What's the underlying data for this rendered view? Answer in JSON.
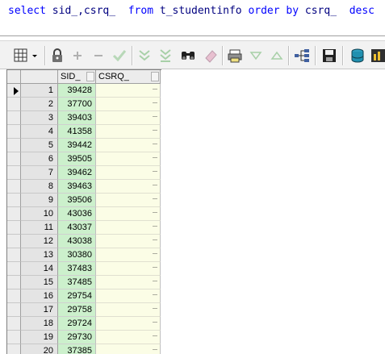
{
  "sql": {
    "kw_select": "select",
    "cols": "sid_,csrq_",
    "kw_from": "from",
    "table": "t_studentinfo",
    "kw_order": "order by",
    "order_col": "csrq_",
    "kw_desc": "desc"
  },
  "toolbar": {
    "icons": [
      "grid-icon",
      "lock-icon",
      "plus-icon",
      "minus-icon",
      "check-icon",
      "filter-down-icon",
      "filter-clear-icon",
      "binoculars-icon",
      "eraser-icon",
      "print-icon",
      "triangle-down-icon",
      "triangle-up-icon",
      "tree-icon",
      "save-icon",
      "database-icon",
      "chart-icon"
    ]
  },
  "grid": {
    "columns": [
      "SID_",
      "CSRQ_"
    ],
    "rows": [
      {
        "n": "1",
        "sid": "39428",
        "csrq": ""
      },
      {
        "n": "2",
        "sid": "37700",
        "csrq": ""
      },
      {
        "n": "3",
        "sid": "39403",
        "csrq": ""
      },
      {
        "n": "4",
        "sid": "41358",
        "csrq": ""
      },
      {
        "n": "5",
        "sid": "39442",
        "csrq": ""
      },
      {
        "n": "6",
        "sid": "39505",
        "csrq": ""
      },
      {
        "n": "7",
        "sid": "39462",
        "csrq": ""
      },
      {
        "n": "8",
        "sid": "39463",
        "csrq": ""
      },
      {
        "n": "9",
        "sid": "39506",
        "csrq": ""
      },
      {
        "n": "10",
        "sid": "43036",
        "csrq": ""
      },
      {
        "n": "11",
        "sid": "43037",
        "csrq": ""
      },
      {
        "n": "12",
        "sid": "43038",
        "csrq": ""
      },
      {
        "n": "13",
        "sid": "30380",
        "csrq": ""
      },
      {
        "n": "14",
        "sid": "37483",
        "csrq": ""
      },
      {
        "n": "15",
        "sid": "37485",
        "csrq": ""
      },
      {
        "n": "16",
        "sid": "29754",
        "csrq": ""
      },
      {
        "n": "17",
        "sid": "29758",
        "csrq": ""
      },
      {
        "n": "18",
        "sid": "29724",
        "csrq": ""
      },
      {
        "n": "19",
        "sid": "29730",
        "csrq": ""
      },
      {
        "n": "20",
        "sid": "37385",
        "csrq": ""
      }
    ],
    "cell_button": "···"
  }
}
